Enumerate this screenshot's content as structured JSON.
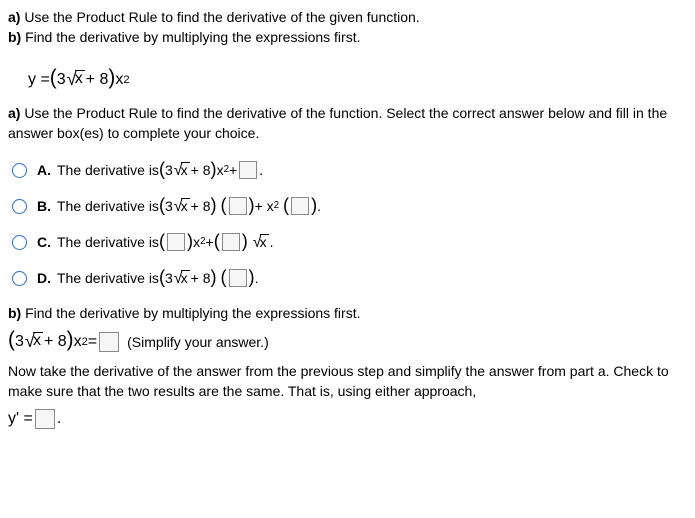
{
  "intro": {
    "a_label": "a)",
    "a_text": " Use the Product Rule to find the derivative of the given function.",
    "b_label": "b)",
    "b_text": " Find the derivative by multiplying the expressions first."
  },
  "main_eq": {
    "lhs": "y = ",
    "open": "(",
    "coef": "3",
    "radicand": "x",
    "plus8": " + 8",
    "close": ")",
    "xsq": " x",
    "exp2": "2"
  },
  "part_a_prompt_label": "a)",
  "part_a_prompt_text": " Use the Product Rule to find the derivative of the function. Select the correct answer below and fill in the answer box(es) to complete your choice.",
  "choices": {
    "A": {
      "letter": "A.",
      "lead": "The derivative is ",
      "tail_plus": " + ",
      "period": "."
    },
    "B": {
      "letter": "B.",
      "lead": "The derivative is ",
      "mid_plus": " + x",
      "period": "."
    },
    "C": {
      "letter": "C.",
      "lead": "The derivative is ",
      "x2plus": " x",
      "plus": " + ",
      "period": "."
    },
    "D": {
      "letter": "D.",
      "lead": "The derivative is ",
      "period": "."
    }
  },
  "part_b_prompt_label": "b)",
  "part_b_prompt_text": " Find the derivative by multiplying the expressions first.",
  "part_b_eq": {
    "equals": " = ",
    "note": "(Simplify your answer.)"
  },
  "final_text": "Now take the derivative of the answer from the previous step and simplify the answer from part a.  Check to make sure that the two results are the same. That is, using either approach,",
  "final_eq": {
    "lhs": "y' = ",
    "period": "."
  }
}
